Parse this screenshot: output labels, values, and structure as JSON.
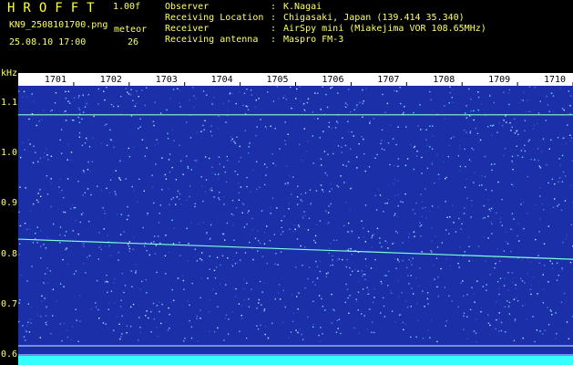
{
  "header": {
    "app_name": "HROFFT",
    "version": "1.00f",
    "filename": "KN9_2508101700.png",
    "mode": "meteor",
    "datetime": "25.08.10 17:00",
    "count": "26",
    "fields": [
      {
        "label": "Observer",
        "value": "K.Nagai"
      },
      {
        "label": "Receiving Location",
        "value": "Chigasaki, Japan (139.414 35.340)"
      },
      {
        "label": "Receiver",
        "value": "AirSpy mini (Miakejima VOR 108.65MHz)"
      },
      {
        "label": "Receiving antenna",
        "value": "Maspro FM-3"
      }
    ]
  },
  "chart_data": {
    "type": "spectrogram",
    "ylabel": "kHz",
    "y_ticks": [
      "1.1",
      "1.0",
      "0.9",
      "0.8",
      "0.7",
      "0.6"
    ],
    "x_ticks": [
      "1701",
      "1702",
      "1703",
      "1704",
      "1705",
      "1706",
      "1707",
      "1708",
      "1709",
      "1710"
    ],
    "x_range": [
      1700,
      1710
    ],
    "y_range": [
      0.58,
      1.16
    ],
    "background": "#1a2fa8",
    "lines": [
      {
        "y": 1.077,
        "color": "#7fffd4"
      },
      {
        "y_start": 0.83,
        "y_end": 0.79,
        "color": "#7fffd4"
      },
      {
        "y": 0.618,
        "color": "#b0c8ff"
      },
      {
        "y": 0.6,
        "color": "#b0c8ff"
      }
    ]
  }
}
